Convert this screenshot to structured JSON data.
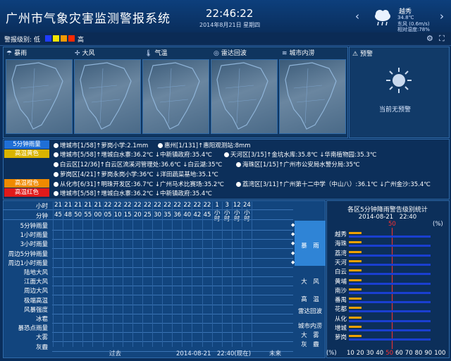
{
  "header": {
    "title": "广州市气象灾害监测警报系统",
    "time": "22:46:22",
    "date": "2014年8月21日 星期四",
    "location": "越秀",
    "temperature": "34.8℃",
    "wind": "东风 (0.6m/s)",
    "humidity": "相对湿度:78%",
    "weather_icon": "rain-cloud-icon"
  },
  "level_bar": {
    "label": "警报级别: 低",
    "high": "高",
    "colors": [
      "#1f3cff",
      "#f5e400",
      "#f59a00",
      "#ff2a00"
    ]
  },
  "maps": {
    "tabs": [
      {
        "label": "暴雨",
        "icon": "rain-icon"
      },
      {
        "label": "大风",
        "icon": "wind-turbine-icon"
      },
      {
        "label": "气温",
        "icon": "thermometer-icon"
      },
      {
        "label": "雷达回波",
        "icon": "radar-icon"
      },
      {
        "label": "城市内涝",
        "icon": "flood-icon"
      }
    ]
  },
  "warning": {
    "title": "预警",
    "no_warning": "当前无预警"
  },
  "alerts": {
    "rows": [
      {
        "tag": "5分钟雨量",
        "tag_color": "#1f6fd6",
        "items": [
          "增城市[1/58]↑萝岗小学:2.1mm",
          "惠州[1/131]↑惠阳观测站:8mm"
        ]
      },
      {
        "tag": "高温黄色",
        "tag_color": "#d9b400",
        "items": [
          "增城市[5/58]↑增城白水寨:36.2℃ ↓中新镇政府:35.4℃",
          "天河区[3/15]↑金坑水库:35.8℃ ↓华南植物园:35.3℃"
        ]
      },
      {
        "tag": "",
        "tag_color": "",
        "items": [
          "白云区[12/36]↑白云区流溪河管理处:36.6℃ ↓白云湖:35℃",
          "海珠区[1/15]↑广州市公安局水警分局:35℃"
        ]
      },
      {
        "tag": "",
        "tag_color": "",
        "items": [
          "萝岗区[4/21]↑萝岗永岗小学:36℃ ↓洋田蔬菜基地:35.1℃"
        ]
      },
      {
        "tag": "高温橙色",
        "tag_color": "#f08a00",
        "items": [
          "从化市[6/31]↑明珠开发区:36.7℃ ↓广州马术比赛场:35.2℃",
          "荔湾区[3/11]↑广州第十二中学（中山八）:36.1℃ ↓广州金沙:35.4℃"
        ]
      },
      {
        "tag": "高温红色",
        "tag_color": "#e01a1a",
        "items": [
          "增城市[5/58]↑增城白水寨:36.2℃ ↓中新镇政府:35.4℃"
        ]
      }
    ]
  },
  "grid": {
    "hour_label": "小时",
    "minute_label": "分钟",
    "hours": [
      "21",
      "21",
      "21",
      "21",
      "21",
      "22",
      "22",
      "22",
      "22",
      "22",
      "22",
      "22",
      "22",
      "22",
      "22",
      "22",
      "22",
      "22"
    ],
    "minutes": [
      "45",
      "48",
      "50",
      "55",
      "00",
      "05",
      "10",
      "15",
      "20",
      "25",
      "30",
      "35",
      "36",
      "40",
      "42",
      "45"
    ],
    "future_cols": [
      [
        "1",
        "小",
        "时"
      ],
      [
        "3",
        "小",
        "时"
      ],
      [
        "12",
        "小",
        "时"
      ],
      [
        "24",
        "小",
        "时"
      ]
    ],
    "rows": [
      "5分钟雨量",
      "1小时雨量",
      "3小时雨量",
      "周边5分钟雨量",
      "周边1小时雨量",
      "陆地大风",
      "江面大风",
      "周边大风",
      "极端高温",
      "风暴强度",
      "冰雹",
      "暴恐点雨量",
      "大雾",
      "灰霾"
    ],
    "categories": [
      "暴　雨",
      "大　风",
      "高　温",
      "雷达回波",
      "城市内涝",
      "大　雾",
      "灰　霾"
    ],
    "footer_past": "过去",
    "footer_now": "2014-08-21　22:40(现在)",
    "footer_future": "未来"
  },
  "stats": {
    "title": "各区5分钟降雨警告级别统计",
    "subtitle": "2014-08-21　22:40",
    "unit": "(%)",
    "marker": "50",
    "axis_prefix": "(%)",
    "axis": [
      "10",
      "20",
      "30",
      "40",
      "50",
      "60",
      "70",
      "80",
      "90",
      "100"
    ],
    "districts": [
      "越秀",
      "海珠",
      "荔湾",
      "天河",
      "白云",
      "黄埔",
      "南沙",
      "番禺",
      "花都",
      "从化",
      "增城",
      "萝岗"
    ]
  },
  "chart_data": {
    "type": "bar",
    "title": "各区5分钟降雨警告级别统计",
    "subtitle": "2014-08-21 22:40",
    "categories": [
      "越秀",
      "海珠",
      "荔湾",
      "天河",
      "白云",
      "黄埔",
      "南沙",
      "番禺",
      "花都",
      "从化",
      "增城",
      "萝岗"
    ],
    "series": [
      {
        "name": "",
        "color": "#f0a000",
        "values": [
          15,
          15,
          15,
          15,
          15,
          15,
          15,
          15,
          15,
          15,
          15,
          15
        ]
      },
      {
        "name": "",
        "color": "#1a3fd0",
        "values": [
          95,
          95,
          95,
          95,
          95,
          95,
          95,
          95,
          95,
          95,
          95,
          95
        ]
      }
    ],
    "xlim": [
      0,
      100
    ],
    "ylabel": "",
    "xlabel": "(%)",
    "legend": "none",
    "grid": false
  }
}
